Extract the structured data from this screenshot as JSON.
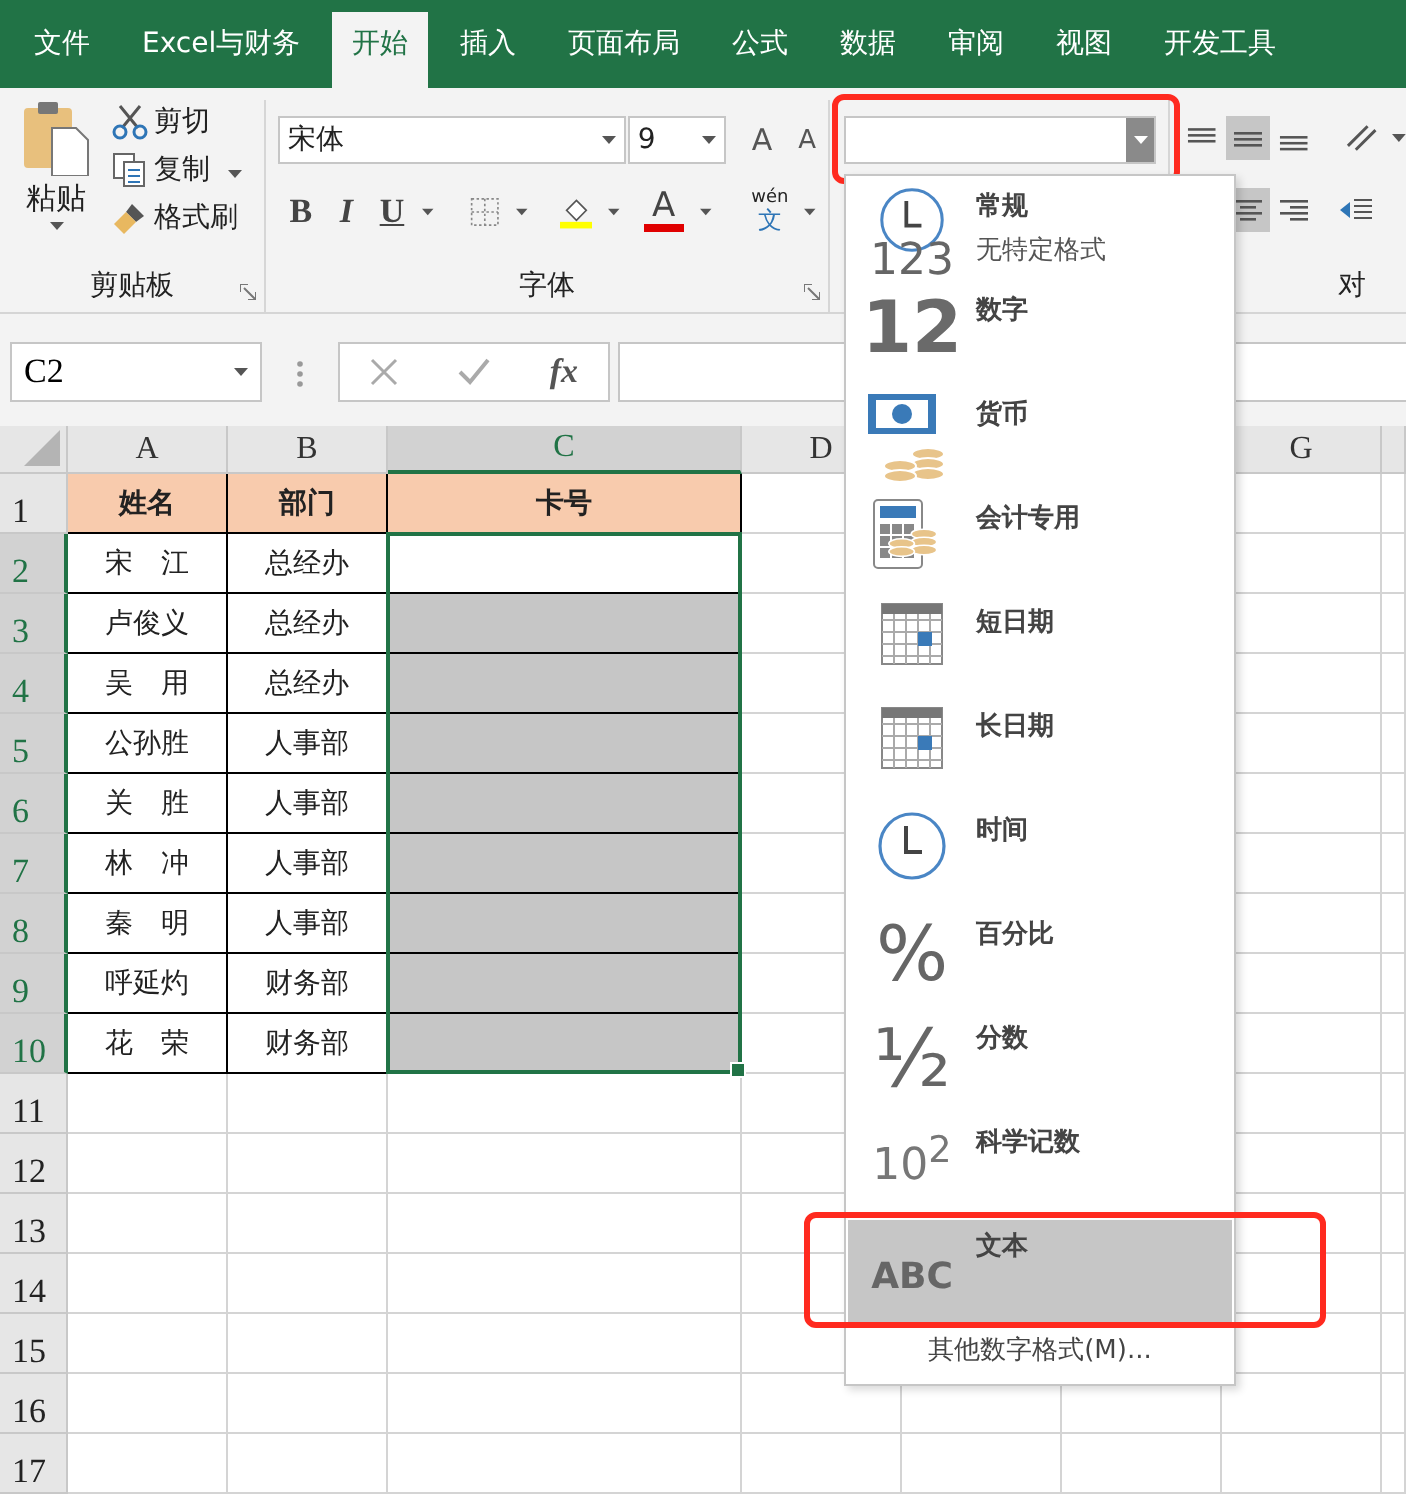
{
  "ribbon_tabs": [
    {
      "label": "文件",
      "selected": false
    },
    {
      "label": "Excel与财务",
      "selected": false
    },
    {
      "label": "开始",
      "selected": true
    },
    {
      "label": "插入",
      "selected": false
    },
    {
      "label": "页面布局",
      "selected": false
    },
    {
      "label": "公式",
      "selected": false
    },
    {
      "label": "数据",
      "selected": false
    },
    {
      "label": "审阅",
      "selected": false
    },
    {
      "label": "视图",
      "selected": false
    },
    {
      "label": "开发工具",
      "selected": false
    }
  ],
  "clipboard": {
    "paste": "粘贴",
    "cut": "剪切",
    "copy": "复制",
    "format_painter": "格式刷",
    "group_label": "剪贴板"
  },
  "font": {
    "name": "宋体",
    "size": "9",
    "grow": "A",
    "shrink": "A",
    "bold": "B",
    "italic": "I",
    "underline": "U",
    "font_color": "A",
    "phonetic_top": "wén",
    "phonetic_bottom": "文",
    "group_label": "字体"
  },
  "alignment": {
    "group_label": "对",
    "middle_align_on": true,
    "center_align_on": true
  },
  "number_format": {
    "highlighted": true
  },
  "formula_bar": {
    "name_box": "C2",
    "insert_function": "fx"
  },
  "sheet": {
    "columns": [
      {
        "label": "A",
        "selected": false
      },
      {
        "label": "B",
        "selected": false
      },
      {
        "label": "C",
        "selected": true
      },
      {
        "label": "D",
        "selected": false
      },
      {
        "label": "G",
        "selected": false
      }
    ],
    "rows": [
      {
        "number": "1",
        "selected": false,
        "active": false,
        "cells": [
          "姓名",
          "部门",
          "卡号"
        ]
      },
      {
        "number": "2",
        "selected": true,
        "active": true,
        "cells": [
          "宋　江",
          "总经办"
        ]
      },
      {
        "number": "3",
        "selected": true,
        "active": false,
        "cells": [
          "卢俊义",
          "总经办"
        ]
      },
      {
        "number": "4",
        "selected": true,
        "active": false,
        "cells": [
          "吴　用",
          "总经办"
        ]
      },
      {
        "number": "5",
        "selected": true,
        "active": false,
        "cells": [
          "公孙胜",
          "人事部"
        ]
      },
      {
        "number": "6",
        "selected": true,
        "active": false,
        "cells": [
          "关　胜",
          "人事部"
        ]
      },
      {
        "number": "7",
        "selected": true,
        "active": false,
        "cells": [
          "林　冲",
          "人事部"
        ]
      },
      {
        "number": "8",
        "selected": true,
        "active": false,
        "cells": [
          "秦　明",
          "人事部"
        ]
      },
      {
        "number": "9",
        "selected": true,
        "active": false,
        "cells": [
          "呼延灼",
          "财务部"
        ]
      },
      {
        "number": "10",
        "selected": true,
        "active": false,
        "cells": [
          "花　荣",
          "财务部"
        ]
      },
      {
        "number": "11",
        "selected": false,
        "active": false
      },
      {
        "number": "12",
        "selected": false,
        "active": false
      },
      {
        "number": "13",
        "selected": false,
        "active": false
      },
      {
        "number": "14",
        "selected": false,
        "active": false
      },
      {
        "number": "15",
        "selected": false,
        "active": false
      },
      {
        "number": "16",
        "selected": false,
        "active": false
      },
      {
        "number": "17",
        "selected": false,
        "active": false
      }
    ]
  },
  "format_menu": {
    "items": [
      {
        "kind": "general",
        "label": "常规",
        "description": "无特定格式",
        "icon_text": "123",
        "selected": false,
        "highlighted": false
      },
      {
        "kind": "number",
        "label": "数字",
        "icon_text": "12",
        "selected": false,
        "highlighted": false
      },
      {
        "kind": "currency",
        "label": "货币",
        "selected": false,
        "highlighted": false
      },
      {
        "kind": "accounting",
        "label": "会计专用",
        "selected": false,
        "highlighted": false
      },
      {
        "kind": "short-date",
        "label": "短日期",
        "selected": false,
        "highlighted": false
      },
      {
        "kind": "long-date",
        "label": "长日期",
        "selected": false,
        "highlighted": false
      },
      {
        "kind": "time",
        "label": "时间",
        "selected": false,
        "highlighted": false
      },
      {
        "kind": "percent",
        "label": "百分比",
        "icon_text": "%",
        "selected": false,
        "highlighted": false
      },
      {
        "kind": "fraction",
        "label": "分数",
        "icon_text": "½",
        "selected": false,
        "highlighted": false
      },
      {
        "kind": "scientific",
        "label": "科学记数",
        "icon_text": "10$^{2}$",
        "selected": false,
        "highlighted": false
      },
      {
        "kind": "text",
        "label": "文本",
        "icon_text": "ABC",
        "selected": true,
        "highlighted": true
      }
    ],
    "more": "其他数字格式(M)..."
  }
}
